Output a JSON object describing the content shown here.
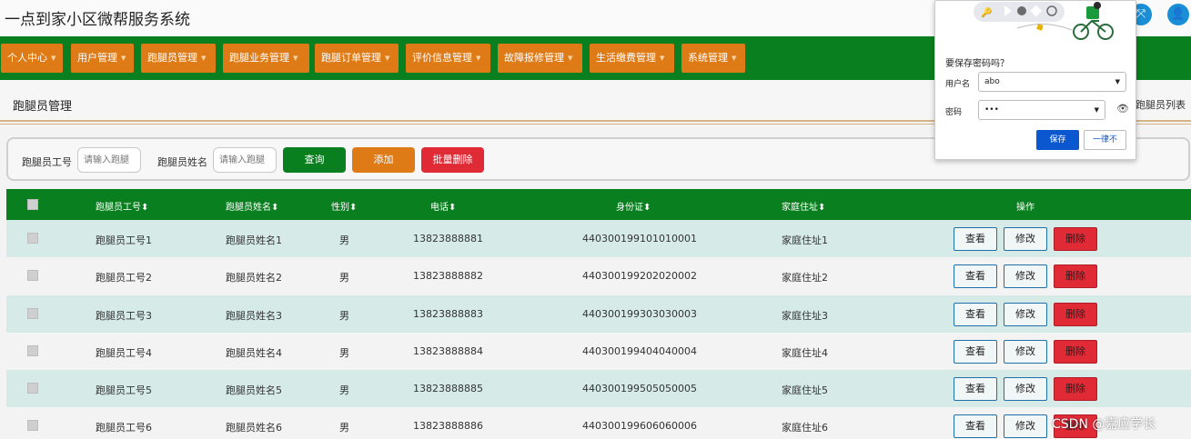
{
  "app": {
    "title": "一点到家小区微帮服务系统"
  },
  "nav": {
    "items": [
      "个人中心",
      "用户管理",
      "跑腿员管理",
      "跑腿业务管理",
      "跑腿订单管理",
      "评价信息管理",
      "故障报修管理",
      "生活缴费管理",
      "系统管理"
    ]
  },
  "breadcrumb": {
    "page_title": "跑腿员管理",
    "right_text": "跑腿员列表"
  },
  "search": {
    "id_label": "跑腿员工号",
    "id_placeholder": "请输入跑腿",
    "name_label": "跑腿员姓名",
    "name_placeholder": "请输入跑腿",
    "query_label": "查询",
    "add_label": "添加",
    "batch_delete_label": "批量删除"
  },
  "table": {
    "headers": [
      "跑腿员工号",
      "跑腿员姓名",
      "性别",
      "电话",
      "身份证",
      "家庭住址",
      "操作"
    ],
    "sort_icon": "⬍",
    "rows": [
      [
        "跑腿员工号1",
        "跑腿员姓名1",
        "男",
        "13823888881",
        "440300199101010001",
        "家庭住址1"
      ],
      [
        "跑腿员工号2",
        "跑腿员姓名2",
        "男",
        "13823888882",
        "440300199202020002",
        "家庭住址2"
      ],
      [
        "跑腿员工号3",
        "跑腿员姓名3",
        "男",
        "13823888883",
        "440300199303030003",
        "家庭住址3"
      ],
      [
        "跑腿员工号4",
        "跑腿员姓名4",
        "男",
        "13823888884",
        "440300199404040004",
        "家庭住址4"
      ],
      [
        "跑腿员工号5",
        "跑腿员姓名5",
        "男",
        "13823888885",
        "440300199505050005",
        "家庭住址5"
      ],
      [
        "跑腿员工号6",
        "跑腿员姓名6",
        "男",
        "13823888886",
        "440300199606060006",
        "家庭住址6"
      ]
    ],
    "actions": {
      "view": "查看",
      "edit": "修改",
      "delete": "删除"
    }
  },
  "password_popup": {
    "question": "要保存密码吗？",
    "username_label": "用户名",
    "username_value": "abo",
    "password_label": "密码",
    "password_value": "•••",
    "save_label": "保存",
    "never_label": "一律不"
  },
  "watermark": "CSDN @嘉应学长",
  "colors": {
    "nav_green": "#0a7f1f",
    "nav_orange": "#df7b17",
    "btn_query": "#0a7f1f",
    "btn_add": "#df7b17",
    "btn_delete": "#e02b37",
    "row_alt": "#d6ebe8",
    "popup_blue": "#0b57d0"
  }
}
